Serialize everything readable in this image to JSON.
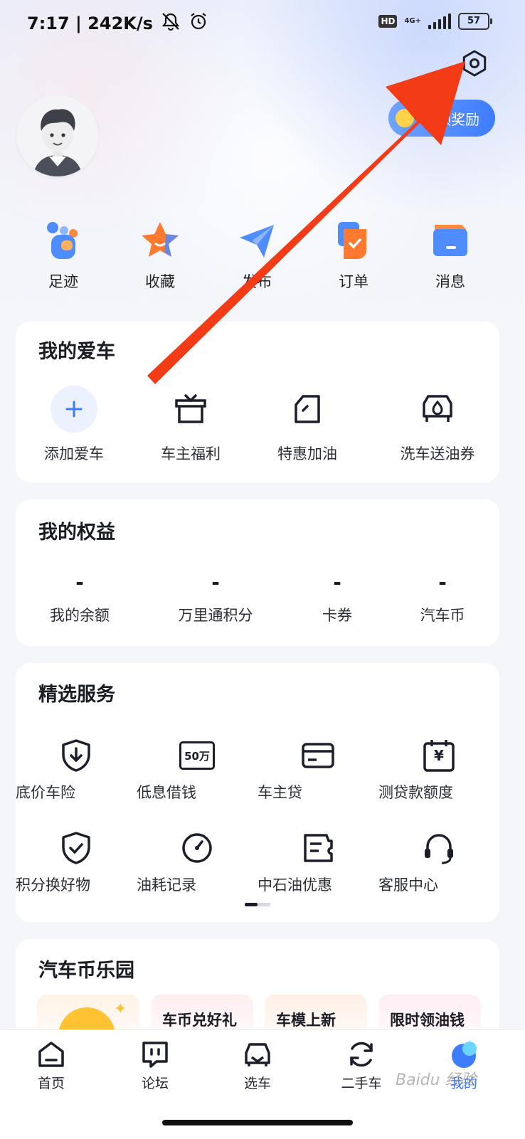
{
  "status_bar": {
    "time_speed": "7:17 | 242K/s",
    "network": "4G+",
    "hd": "HD",
    "battery": "57"
  },
  "header": {
    "reward_label": "领奖励"
  },
  "quick_actions": [
    {
      "label": "足迹",
      "icon": "footprint-icon"
    },
    {
      "label": "收藏",
      "icon": "star-icon"
    },
    {
      "label": "发布",
      "icon": "paper-plane-icon"
    },
    {
      "label": "订单",
      "icon": "order-icon"
    },
    {
      "label": "消息",
      "icon": "message-icon"
    }
  ],
  "my_car": {
    "title": "我的爱车",
    "items": [
      {
        "label": "添加爱车",
        "icon": "plus-icon"
      },
      {
        "label": "车主福利",
        "icon": "gift-icon"
      },
      {
        "label": "特惠加油",
        "icon": "fuel-icon"
      },
      {
        "label": "洗车送油券",
        "icon": "car-wash-icon"
      }
    ]
  },
  "my_rights": {
    "title": "我的权益",
    "items": [
      {
        "value": "-",
        "label": "我的余额"
      },
      {
        "value": "-",
        "label": "万里通积分"
      },
      {
        "value": "-",
        "label": "卡券"
      },
      {
        "value": "-",
        "label": "汽车币"
      }
    ]
  },
  "services": {
    "title": "精选服务",
    "items": [
      {
        "label": "底价车险",
        "icon": "shield-down-icon"
      },
      {
        "label": "低息借钱",
        "icon": "loan-50w-icon",
        "icon_text": "50万"
      },
      {
        "label": "车主贷",
        "icon": "card-icon"
      },
      {
        "label": "测贷款额度",
        "icon": "calendar-yen-icon",
        "icon_text": "¥"
      },
      {
        "label": "积分换好物",
        "icon": "shield-check-icon"
      },
      {
        "label": "油耗记录",
        "icon": "gauge-icon"
      },
      {
        "label": "中石油优惠",
        "icon": "coupon-icon"
      },
      {
        "label": "客服中心",
        "icon": "headset-icon"
      }
    ]
  },
  "coin_park": {
    "title": "汽车币乐园",
    "cards": [
      {
        "label": "车币兑好礼"
      },
      {
        "label": "车模上新"
      },
      {
        "label": "限时领油钱"
      }
    ]
  },
  "tabbar": [
    {
      "label": "首页",
      "icon": "home-icon"
    },
    {
      "label": "论坛",
      "icon": "forum-icon"
    },
    {
      "label": "选车",
      "icon": "car-select-icon"
    },
    {
      "label": "二手车",
      "icon": "used-car-icon"
    },
    {
      "label": "我的",
      "icon": "profile-icon",
      "active": true
    }
  ],
  "colors": {
    "accent": "#3d7cff",
    "annotation_arrow": "#f33b16",
    "text": "#1a1c24"
  }
}
